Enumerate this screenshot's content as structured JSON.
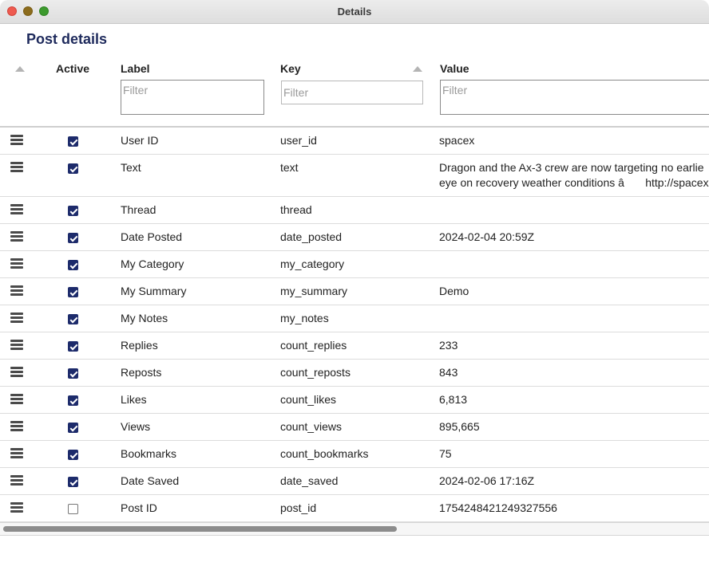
{
  "window": {
    "title": "Details"
  },
  "heading": "Post details",
  "columns": {
    "active": "Active",
    "label": "Label",
    "key": "Key",
    "value": "Value"
  },
  "filters": {
    "label_placeholder": "Filter",
    "key_placeholder": "Filter",
    "value_placeholder": "Filter"
  },
  "rows": [
    {
      "active": true,
      "label": "User ID",
      "key": "user_id",
      "value": "spacex"
    },
    {
      "active": true,
      "label": "Text",
      "key": "text",
      "value": "Dragon and the Ax-3 crew are now targeting no earlie\neye on recovery weather conditions â http://spacex."
    },
    {
      "active": true,
      "label": "Thread",
      "key": "thread",
      "value": ""
    },
    {
      "active": true,
      "label": "Date Posted",
      "key": "date_posted",
      "value": "2024-02-04 20:59Z"
    },
    {
      "active": true,
      "label": "My Category",
      "key": "my_category",
      "value": ""
    },
    {
      "active": true,
      "label": "My Summary",
      "key": "my_summary",
      "value": "Demo"
    },
    {
      "active": true,
      "label": "My Notes",
      "key": "my_notes",
      "value": ""
    },
    {
      "active": true,
      "label": "Replies",
      "key": "count_replies",
      "value": "233"
    },
    {
      "active": true,
      "label": "Reposts",
      "key": "count_reposts",
      "value": "843"
    },
    {
      "active": true,
      "label": "Likes",
      "key": "count_likes",
      "value": "6,813"
    },
    {
      "active": true,
      "label": "Views",
      "key": "count_views",
      "value": "895,665"
    },
    {
      "active": true,
      "label": "Bookmarks",
      "key": "count_bookmarks",
      "value": "75"
    },
    {
      "active": true,
      "label": "Date Saved",
      "key": "date_saved",
      "value": "2024-02-06 17:16Z"
    },
    {
      "active": false,
      "label": "Post ID",
      "key": "post_id",
      "value": "1754248421249327556"
    }
  ],
  "colors": {
    "accent": "#1d2b6b",
    "heading": "#1e2a5c",
    "close": "#ee5a4f",
    "minimize": "#8c6c1d",
    "zoom": "#3d9a2e"
  },
  "icons": [
    "drag-handle-icon",
    "sort-arrow-icon",
    "checkbox-icon"
  ]
}
